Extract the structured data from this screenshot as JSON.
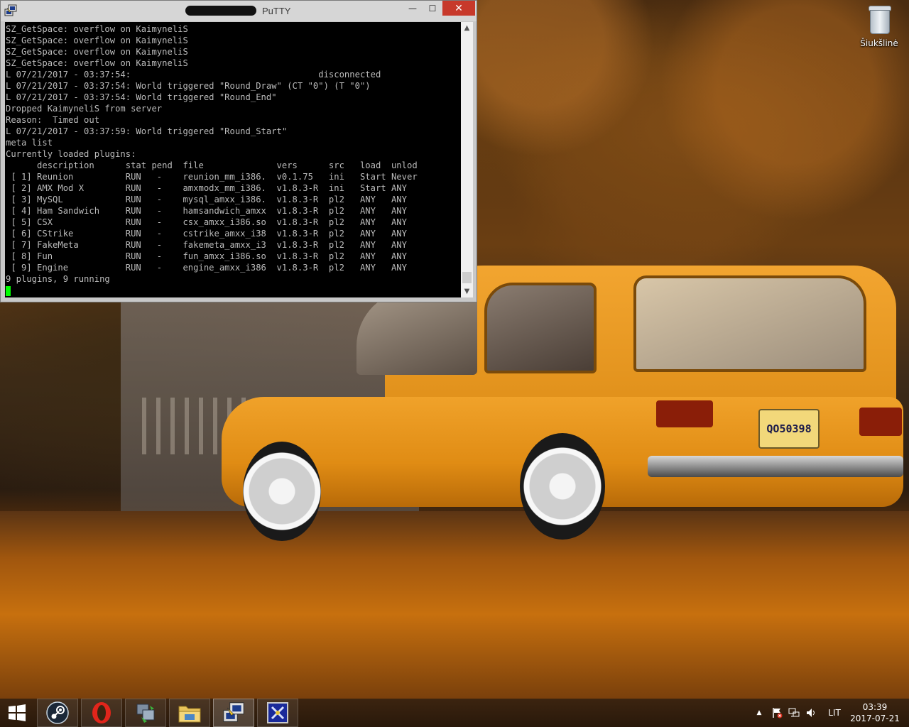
{
  "window": {
    "title": "PuTTY",
    "controls": {
      "minimize": "—",
      "maximize": "☐",
      "close": "✕"
    }
  },
  "terminal": {
    "lines": [
      "SZ_GetSpace: overflow on KaimyneliS",
      "SZ_GetSpace: overflow on KaimyneliS",
      "SZ_GetSpace: overflow on KaimyneliS",
      "SZ_GetSpace: overflow on KaimyneliS",
      "L 07/21/2017 - 03:37:54:                                    disconnected",
      "L 07/21/2017 - 03:37:54: World triggered \"Round_Draw\" (CT \"0\") (T \"0\")",
      "L 07/21/2017 - 03:37:54: World triggered \"Round_End\"",
      "Dropped KaimyneliS from server",
      "Reason:  Timed out",
      "L 07/21/2017 - 03:37:59: World triggered \"Round_Start\"",
      "meta list",
      "Currently loaded plugins:",
      "      description      stat pend  file              vers      src   load  unlod",
      " [ 1] Reunion          RUN   -    reunion_mm_i386.  v0.1.75   ini   Start Never",
      " [ 2] AMX Mod X        RUN   -    amxmodx_mm_i386.  v1.8.3-R  ini   Start ANY",
      " [ 3] MySQL            RUN   -    mysql_amxx_i386.  v1.8.3-R  pl2   ANY   ANY",
      " [ 4] Ham Sandwich     RUN   -    hamsandwich_amxx  v1.8.3-R  pl2   ANY   ANY",
      " [ 5] CSX              RUN   -    csx_amxx_i386.so  v1.8.3-R  pl2   ANY   ANY",
      " [ 6] CStrike          RUN   -    cstrike_amxx_i38  v1.8.3-R  pl2   ANY   ANY",
      " [ 7] FakeMeta         RUN   -    fakemeta_amxx_i3  v1.8.3-R  pl2   ANY   ANY",
      " [ 8] Fun              RUN   -    fun_amxx_i386.so  v1.8.3-R  pl2   ANY   ANY",
      " [ 9] Engine           RUN   -    engine_amxx_i386  v1.8.3-R  pl2   ANY   ANY",
      "9 plugins, 9 running"
    ],
    "text_color": "#bbbbbb",
    "cursor_color": "#00ff00"
  },
  "desktop": {
    "icons": [
      {
        "label": "Šiukšlinė",
        "icon": "recycle-bin-icon"
      }
    ],
    "wallpaper": {
      "car_plate": "QO50398"
    }
  },
  "taskbar": {
    "apps": [
      {
        "name": "start",
        "icon": "windows-logo-icon"
      },
      {
        "name": "steam",
        "icon": "steam-icon"
      },
      {
        "name": "opera",
        "icon": "opera-icon"
      },
      {
        "name": "network-tool",
        "icon": "network-transfer-icon"
      },
      {
        "name": "file-explorer",
        "icon": "folder-icon"
      },
      {
        "name": "putty",
        "icon": "putty-icon"
      },
      {
        "name": "app-x",
        "icon": "x-app-icon"
      }
    ],
    "tray": {
      "chevron": "▲",
      "language": "LIT",
      "time": "03:39",
      "date": "2017-07-21"
    }
  }
}
